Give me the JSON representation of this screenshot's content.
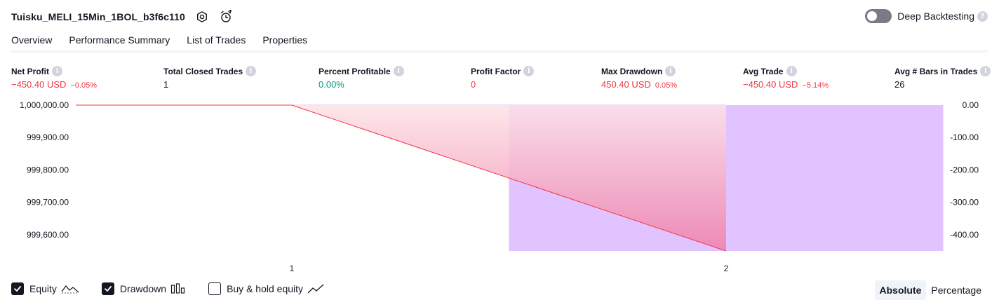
{
  "header": {
    "title": "Tuisku_MELI_15Min_1BOL_b3f6c110",
    "settings_icon": "settings-icon",
    "alert_icon": "alarm-add-icon"
  },
  "deep_backtesting": {
    "label": "Deep Backtesting",
    "enabled": false
  },
  "tabs": [
    {
      "label": "Overview",
      "active": true
    },
    {
      "label": "Performance Summary",
      "active": false
    },
    {
      "label": "List of Trades",
      "active": false
    },
    {
      "label": "Properties",
      "active": false
    }
  ],
  "metrics": [
    {
      "label": "Net Profit",
      "value": "−450.40 USD",
      "pct": "−0.05%",
      "color": "#f23645"
    },
    {
      "label": "Total Closed Trades",
      "value": "1",
      "pct": "",
      "color": "#131722"
    },
    {
      "label": "Percent Profitable",
      "value": "0.00%",
      "pct": "",
      "color": "#089981"
    },
    {
      "label": "Profit Factor",
      "value": "0",
      "pct": "",
      "color": "#f23645"
    },
    {
      "label": "Max Drawdown",
      "value": "450.40 USD",
      "pct": "0.05%",
      "color": "#f23645"
    },
    {
      "label": "Avg Trade",
      "value": "−450.40 USD",
      "pct": "−5.14%",
      "color": "#f23645"
    },
    {
      "label": "Avg # Bars in Trades",
      "value": "26",
      "pct": "",
      "color": "#131722"
    }
  ],
  "chart_data": {
    "type": "line",
    "left_axis": {
      "ticks": [
        "1,000,000.00",
        "999,900.00",
        "999,800.00",
        "999,700.00",
        "999,600.00"
      ],
      "values": [
        1000000,
        999900,
        999800,
        999700,
        999600
      ]
    },
    "right_axis": {
      "ticks": [
        "0.00",
        "-100.00",
        "-200.00",
        "-300.00",
        "-400.00"
      ],
      "values": [
        0,
        -100,
        -200,
        -300,
        -400
      ]
    },
    "x_ticks": [
      "1",
      "2"
    ],
    "equity": {
      "color": "#f23645",
      "points": [
        {
          "x": 0,
          "y": 1000000
        },
        {
          "x": 1,
          "y": 1000000
        },
        {
          "x": 2,
          "y": 999549.6
        }
      ]
    },
    "drawdown": {
      "color": "#e1c4ff",
      "bars": [
        {
          "trade": 2,
          "value": -450.4
        }
      ]
    },
    "colors": {
      "equity_fill_top": "#fde3e6",
      "equity_fill_bottom": "#f07fa9",
      "baseline": "#e8b4e8"
    }
  },
  "legend": [
    {
      "label": "Equity",
      "checked": true,
      "icon": "equity-line-icon"
    },
    {
      "label": "Drawdown",
      "checked": true,
      "icon": "drawdown-bars-icon"
    },
    {
      "label": "Buy & hold equity",
      "checked": false,
      "icon": "buy-hold-line-icon"
    }
  ],
  "modes": [
    {
      "label": "Absolute",
      "active": true
    },
    {
      "label": "Percentage",
      "active": false
    }
  ]
}
